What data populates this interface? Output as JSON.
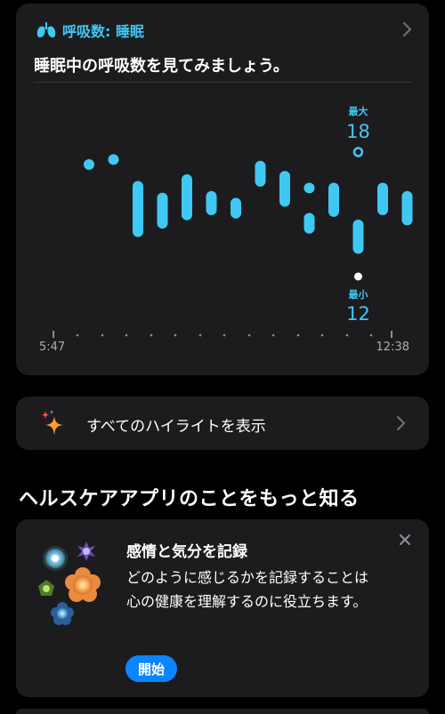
{
  "highlight": {
    "title": "呼吸数: 睡眠",
    "description": "睡眠中の呼吸数を見てみましょう。",
    "max_label": "最大",
    "max_value": "18",
    "min_label": "最小",
    "min_value": "12",
    "start_time": "5:47",
    "end_time": "12:38",
    "accent_color": "#40c8f4"
  },
  "chart_data": {
    "type": "range",
    "title": "呼吸数: 睡眠",
    "x_labels": [
      "5:47",
      "12:38"
    ],
    "ylim": [
      11,
      20
    ],
    "points": [
      {
        "i": 0,
        "low": 17.3,
        "high": 17.3
      },
      {
        "i": 1,
        "low": 17.6,
        "high": 17.6
      },
      {
        "i": 2,
        "low": 13.3,
        "high": 16.0
      },
      {
        "i": 3,
        "low": 13.8,
        "high": 15.3
      },
      {
        "i": 4,
        "low": 14.3,
        "high": 16.4
      },
      {
        "i": 5,
        "low": 14.6,
        "high": 15.4
      },
      {
        "i": 6,
        "low": 14.4,
        "high": 15.0
      },
      {
        "i": 7,
        "low": 16.3,
        "high": 17.2
      },
      {
        "i": 8,
        "low": 15.1,
        "high": 16.6
      },
      {
        "i": 9,
        "low": 13.5,
        "high": 14.1
      },
      {
        "i": 9,
        "low": 15.9,
        "high": 15.9
      },
      {
        "i": 10,
        "low": 14.5,
        "high": 15.9
      },
      {
        "i": 11,
        "low": 12.3,
        "high": 13.7
      },
      {
        "i": 12,
        "low": 14.6,
        "high": 15.9
      },
      {
        "i": 13,
        "low": 14.0,
        "high": 15.4
      }
    ],
    "max": {
      "i": 11,
      "value": 18
    },
    "min": {
      "i": 11,
      "value": 12
    }
  },
  "show_all": {
    "label": "すべてのハイライトを表示",
    "icon": "sparkle-icon"
  },
  "section": {
    "title": "ヘルスケアアプリのことをもっと知る"
  },
  "learn_card": {
    "title": "感情と気分を記録",
    "body": "どのように感じるかを記録することは心の健康を理解するのに役立ちます。",
    "start_label": "開始"
  }
}
